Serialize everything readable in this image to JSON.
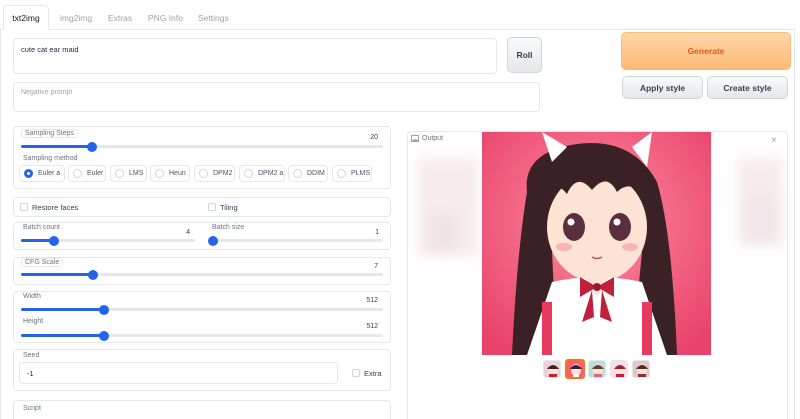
{
  "tabs": [
    {
      "label": "txt2img",
      "active": true
    },
    {
      "label": "img2img"
    },
    {
      "label": "Extras"
    },
    {
      "label": "PNG Info"
    },
    {
      "label": "Settings"
    }
  ],
  "prompt": {
    "value": "cute cat ear maid"
  },
  "negative_prompt": {
    "placeholder": "Negative prompt"
  },
  "buttons": {
    "roll": "Roll",
    "generate": "Generate",
    "apply_style": "Apply style",
    "create_style": "Create style"
  },
  "sampling_steps": {
    "label": "Sampling Steps",
    "value": "20",
    "fraction": 0.195
  },
  "sampling_method": {
    "label": "Sampling method",
    "options": [
      "Euler a",
      "Euler",
      "LMS",
      "Heun",
      "DPM2",
      "DPM2 a",
      "DDIM",
      "PLMS"
    ],
    "selected": "Euler a"
  },
  "restore_faces": {
    "label": "Restore faces",
    "checked": false
  },
  "tiling": {
    "label": "Tiling",
    "checked": false
  },
  "batch_count": {
    "label": "Batch count",
    "value": "4",
    "fraction": 0.19
  },
  "batch_size": {
    "label": "Batch size",
    "value": "1",
    "fraction": 0.0
  },
  "cfg_scale": {
    "label": "CFG Scale",
    "value": "7",
    "fraction": 0.2
  },
  "width": {
    "label": "Width",
    "value": "512",
    "fraction": 0.23
  },
  "height": {
    "label": "Height",
    "value": "512",
    "fraction": 0.23
  },
  "seed": {
    "label": "Seed",
    "value": "-1"
  },
  "extra": {
    "label": "Extra",
    "checked": false
  },
  "script": {
    "label": "Script"
  },
  "output": {
    "label": "Output",
    "close_icon": "close-icon",
    "selected_thumbnail": 2,
    "thumbnail_count": 5
  },
  "colors": {
    "accent": "#2563eb",
    "generate_bg": "#fdba74",
    "generate_text": "#ea580c",
    "image_bg": "#f45d7a"
  }
}
